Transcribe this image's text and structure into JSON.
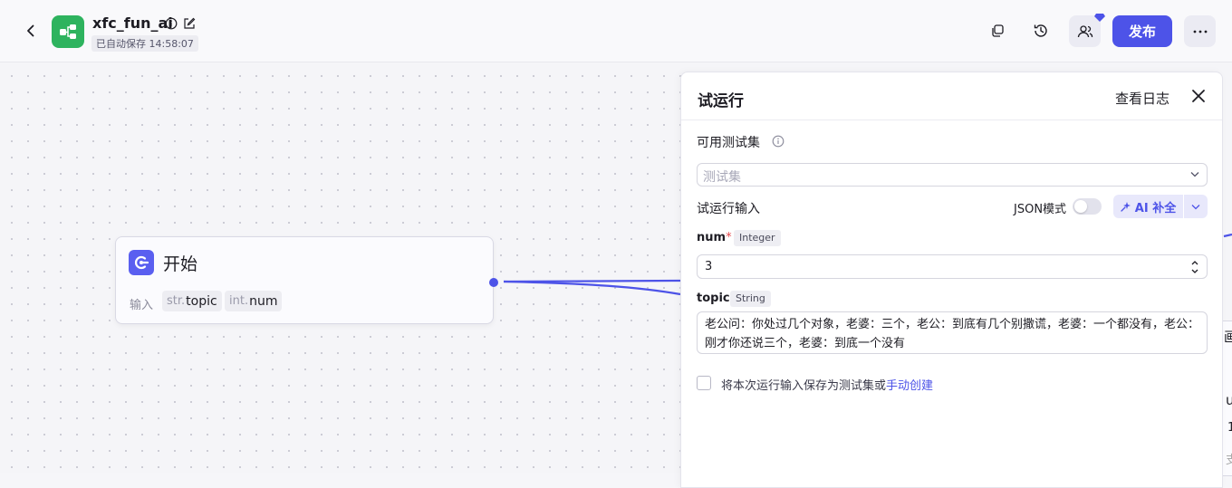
{
  "header": {
    "app_name": "xfc_fun_ai",
    "autosave": "已自动保存 14:58:07",
    "publish_label": "发布",
    "colors": {
      "logo": "#2eb35e",
      "accent": "#4d53e8"
    },
    "icons": [
      "back-arrow-icon",
      "workflow-icon",
      "info-icon",
      "edit-icon",
      "copy-icon",
      "history-icon",
      "collaborator-icon",
      "more-icon"
    ]
  },
  "canvas": {
    "start_node": {
      "title": "开始",
      "input_label": "输入",
      "vars": [
        {
          "type": "str.",
          "name": "topic"
        },
        {
          "type": "int.",
          "name": "num"
        }
      ]
    },
    "partial_node": {
      "c1": "画",
      "c2": "ut",
      "c3": "1",
      "c4": "支"
    }
  },
  "panel": {
    "title": "试运行",
    "view_log": "查看日志",
    "testset_label": "可用测试集",
    "testset_placeholder": "测试集",
    "run_input_label": "试运行输入",
    "json_mode_label": "JSON模式",
    "json_mode_on": false,
    "ai_fill_label": "AI 补全",
    "fields": {
      "num": {
        "name": "num",
        "required_mark": "*",
        "type": "Integer",
        "value": "3"
      },
      "topic": {
        "name": "topic",
        "type": "String",
        "value": "老公问：你处过几个对象，老婆：三个，老公：到底有几个别撒谎，老婆：一个都没有，老公：刚才你还说三个，老婆：到底一个没有"
      }
    },
    "save_checkbox_checked": false,
    "save_text": "将本次运行输入保存为测试集或",
    "manual_create_link": "手动创建"
  }
}
